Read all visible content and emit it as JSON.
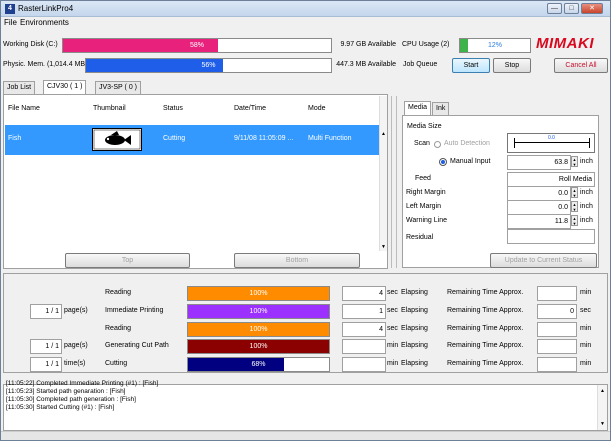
{
  "window": {
    "title": "RasterLinkPro4",
    "app_icon": "4"
  },
  "menu": [
    "File",
    "Environments"
  ],
  "status": {
    "working_disk_label": "Working Disk (C:)",
    "working_disk_pct": "58%",
    "working_disk_fraction": 0.58,
    "working_disk_avail": "9.97 GB Available",
    "phys_mem_label": "Physic. Mem. (1,014.4 MB)",
    "phys_mem_pct": "56%",
    "phys_mem_fraction": 0.56,
    "phys_mem_avail": "447.3 MB Available",
    "cpu_label": "CPU Usage (2)",
    "cpu_pct": "12%",
    "cpu_fraction": 0.12,
    "job_queue_label": "Job Queue",
    "start": "Start",
    "stop": "Stop",
    "cancel_all": "Cancel All",
    "logo": "MIMAKI"
  },
  "tabs": [
    "Job List",
    "CJV30 ( 1 )",
    "JV3-SP ( 0 )"
  ],
  "job_table": {
    "headers": [
      "File Name",
      "Thumbnail",
      "Status",
      "Date/Time",
      "Mode"
    ],
    "rows": [
      {
        "file": "Fish",
        "status": "Cutting",
        "datetime": "9/11/08 11:05:09 ...",
        "mode": "Multi Function"
      }
    ],
    "top": "Top",
    "bottom": "Bottom"
  },
  "media_panel": {
    "tabs": [
      "Media",
      "Ink"
    ],
    "media_size": "Media Size",
    "scan": "Scan",
    "auto_detection": "Auto Detection",
    "scale_value": "0.0",
    "manual_input": "Manual Input",
    "manual_value": "63.8",
    "unit": "inch",
    "feed": "Feed",
    "feed_value": "Roll Media",
    "right_margin": "Right Margin",
    "right_margin_value": "0.0",
    "left_margin": "Left Margin",
    "left_margin_value": "0.0",
    "warning_line": "Warning Line",
    "warning_line_value": "11.8",
    "residual": "Residual",
    "residual_value": "",
    "update": "Update to Current Status"
  },
  "progress": [
    {
      "label": "Reading",
      "pct": "100%",
      "fraction": 1.0,
      "color": "#ff8c00",
      "time": "4",
      "unit": "sec",
      "elapsing": "Elapsing",
      "remaining_label": "Remaining Time Approx.",
      "remaining": "",
      "remaining_unit": "min",
      "count": "",
      "count_unit": ""
    },
    {
      "label": "Immediate Printing",
      "pct": "100%",
      "fraction": 1.0,
      "color": "#9b30ff",
      "time": "1",
      "unit": "sec",
      "elapsing": "Elapsing",
      "remaining_label": "Remaining Time Approx.",
      "remaining": "0",
      "remaining_unit": "sec",
      "count": "1 / 1",
      "count_unit": "page(s)"
    },
    {
      "label": "Reading",
      "pct": "100%",
      "fraction": 1.0,
      "color": "#ff8c00",
      "time": "4",
      "unit": "sec",
      "elapsing": "Elapsing",
      "remaining_label": "Remaining Time Approx.",
      "remaining": "",
      "remaining_unit": "min",
      "count": "",
      "count_unit": ""
    },
    {
      "label": "Generating Cut Path",
      "pct": "100%",
      "fraction": 1.0,
      "color": "#8b0000",
      "time": "",
      "unit": "min",
      "elapsing": "Elapsing",
      "remaining_label": "Remaining Time Approx.",
      "remaining": "",
      "remaining_unit": "min",
      "count": "1 / 1",
      "count_unit": "page(s)"
    },
    {
      "label": "Cutting",
      "pct": "68%",
      "fraction": 0.68,
      "color": "#000080",
      "time": "",
      "unit": "min",
      "elapsing": "Elapsing",
      "remaining_label": "Remaining Time Approx.",
      "remaining": "",
      "remaining_unit": "min",
      "count": "1 / 1",
      "count_unit": "time(s)"
    }
  ],
  "log": [
    "[11:05:22] Completed Immediate Printing (#1) : [Fish]",
    "[11:05:23] Started path genaration : [Fish]",
    "[11:05:30] Completed path generation : [Fish]",
    "[11:05:30] Started Cutting (#1) : [Fish]"
  ]
}
